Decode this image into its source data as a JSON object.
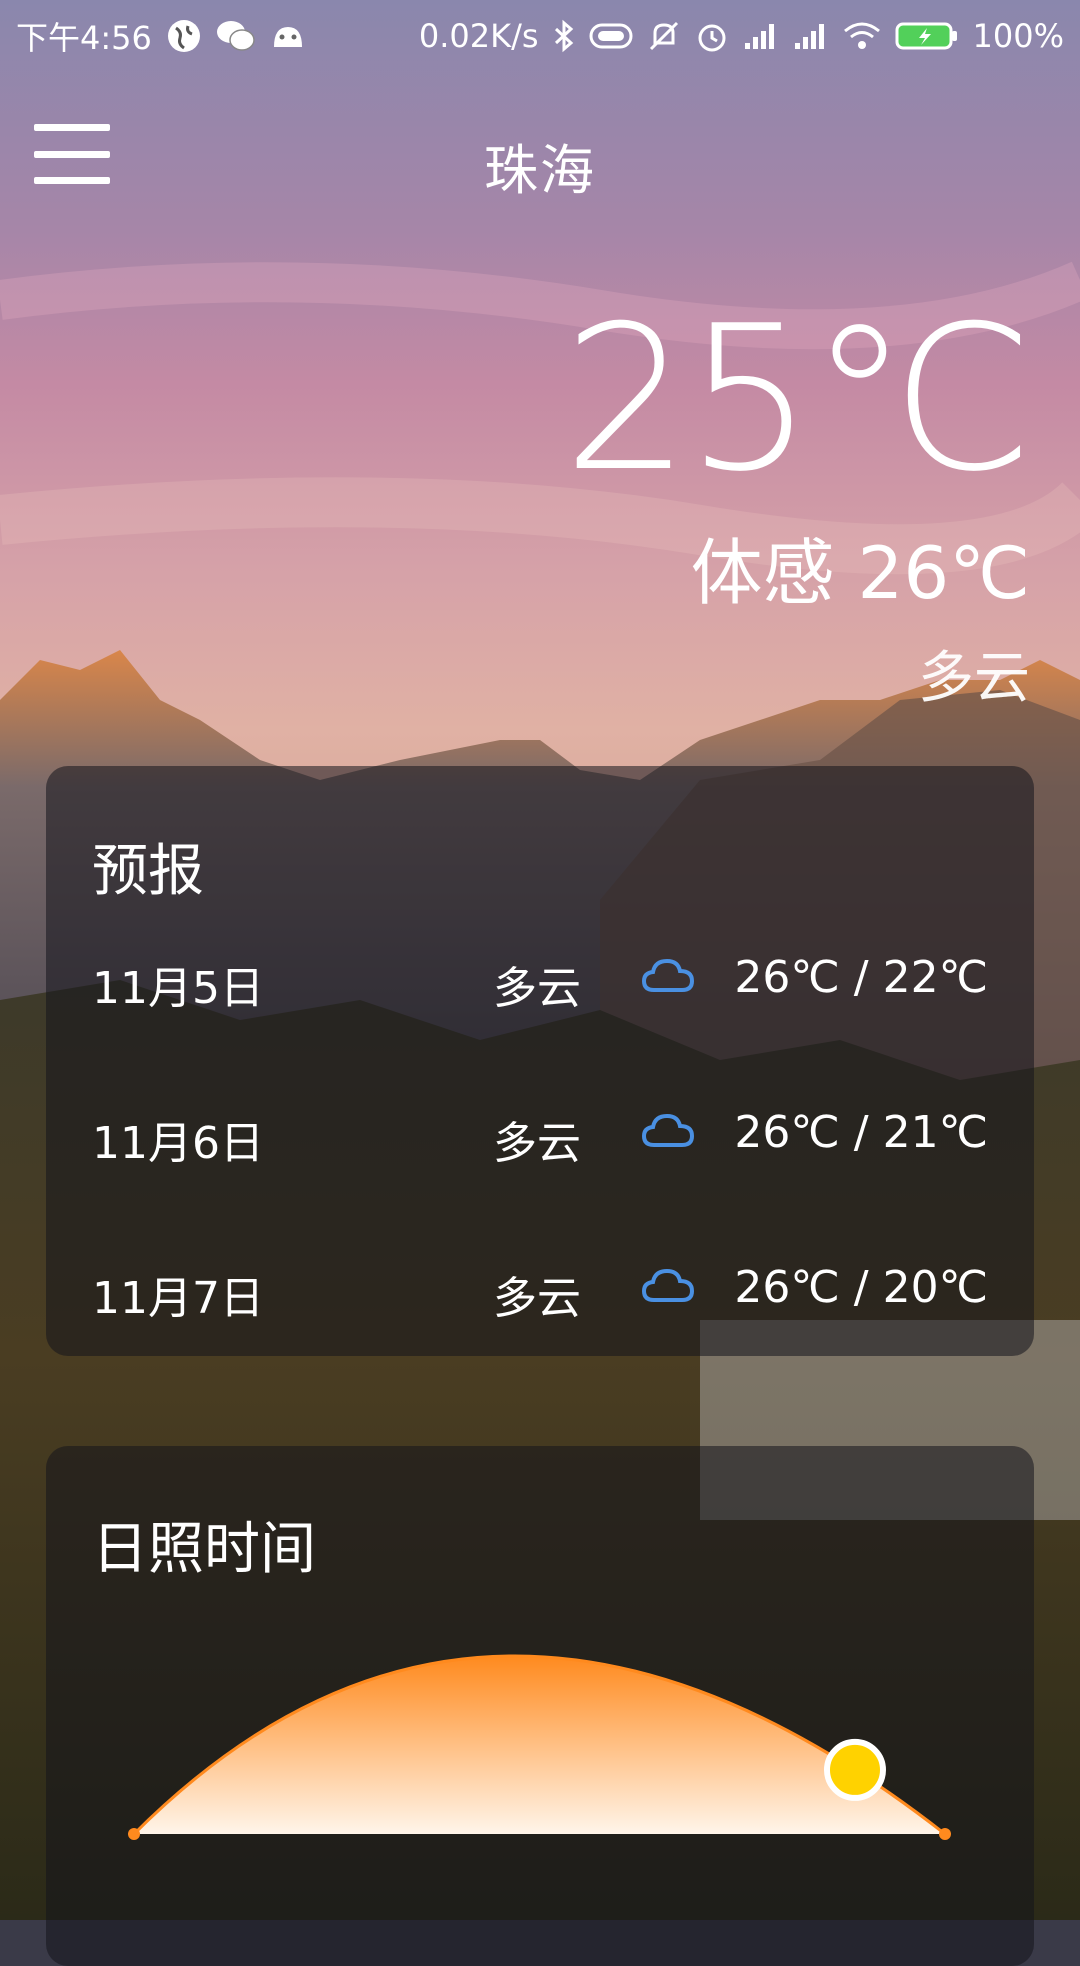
{
  "status_bar": {
    "time": "下午4:56",
    "net_speed": "0.02K/s",
    "battery": "100%"
  },
  "toolbar": {
    "city": "珠海"
  },
  "current": {
    "temperature": "25℃",
    "feels_like": "体感 26℃",
    "condition": "多云"
  },
  "forecast": {
    "title": "预报",
    "rows": [
      {
        "date": "11月5日",
        "condition": "多云",
        "icon": "cloud-icon",
        "temp": "26℃ / 22℃"
      },
      {
        "date": "11月6日",
        "condition": "多云",
        "icon": "cloud-icon",
        "temp": "26℃ / 21℃"
      },
      {
        "date": "11月7日",
        "condition": "多云",
        "icon": "cloud-icon",
        "temp": "26℃ / 20℃"
      }
    ]
  },
  "sunshine": {
    "title": "日照时间",
    "progress": 0.9
  },
  "colors": {
    "accent_orange": "#FF8A1E",
    "sun_yellow": "#FFD200",
    "cloud_icon_blue": "#4A90E2"
  }
}
